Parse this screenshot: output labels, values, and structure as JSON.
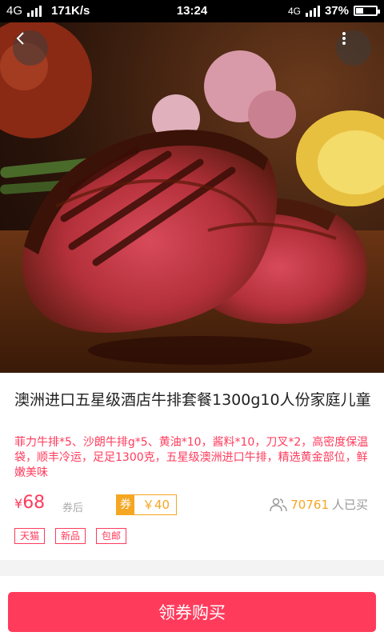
{
  "status_bar": {
    "network": "4G",
    "speed": "171K/s",
    "time": "13:24",
    "network_right": "4G",
    "battery": "37%",
    "battery_level": 0.37
  },
  "product": {
    "title": "澳洲进口五星级酒店牛排套餐1300g10人份家庭儿童",
    "description": "菲力牛排*5、沙朗牛排g*5、黄油*10，酱料*10，刀叉*2，高密度保温袋，顺丰冷运，足足1300克，五星级澳洲进口牛排，精选黄金部位，鲜嫩美味",
    "price_symbol": "¥",
    "price": "68",
    "price_suffix": "券后",
    "coupon_tag": "券",
    "coupon_value": "￥40",
    "sold_count": "70761",
    "sold_suffix": "人已买",
    "tags": [
      "天猫",
      "新品",
      "包邮"
    ]
  },
  "actions": {
    "buy_label": "领券购买"
  },
  "colors": {
    "accent": "#ff3b5c",
    "coupon": "#f5a623"
  }
}
